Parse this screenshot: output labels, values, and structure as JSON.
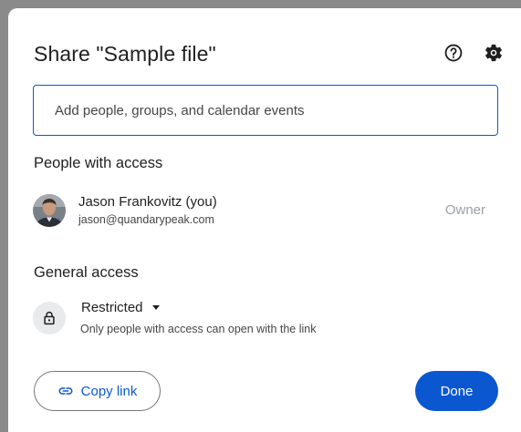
{
  "dialog": {
    "title": "Share \"Sample file\"",
    "help_icon": "help-circle-icon",
    "settings_icon": "gear-icon"
  },
  "add_people": {
    "placeholder": "Add people, groups, and calendar events",
    "value": ""
  },
  "people_with_access": {
    "heading": "People with access",
    "people": [
      {
        "name": "Jason Frankovitz (you)",
        "email": "jason@quandarypeak.com",
        "role": "Owner"
      }
    ]
  },
  "general_access": {
    "heading": "General access",
    "icon": "lock-icon",
    "selected": "Restricted",
    "description": "Only people with access can open with the link"
  },
  "actions": {
    "copy_link_label": "Copy link",
    "copy_link_icon": "link-icon",
    "done_label": "Done"
  },
  "colors": {
    "accent": "#0b57d0",
    "text_primary": "#1f1f1f",
    "text_secondary": "#444746",
    "role_text": "#9aa0a6",
    "lock_bg": "#e9eaec"
  }
}
